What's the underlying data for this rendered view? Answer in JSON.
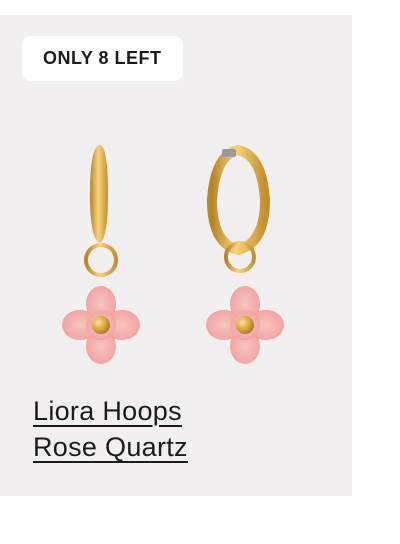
{
  "badge": {
    "text": "ONLY 8 LEFT"
  },
  "product": {
    "title_line1": "Liora Hoops",
    "title_line2": "Rose Quartz",
    "image_icon": "gold-hoop-earrings-with-rose-quartz-flower-charm",
    "colors": {
      "gold": "#e2b24a",
      "rose_quartz": "#f5b3b1",
      "background": "#f2eff0"
    }
  }
}
